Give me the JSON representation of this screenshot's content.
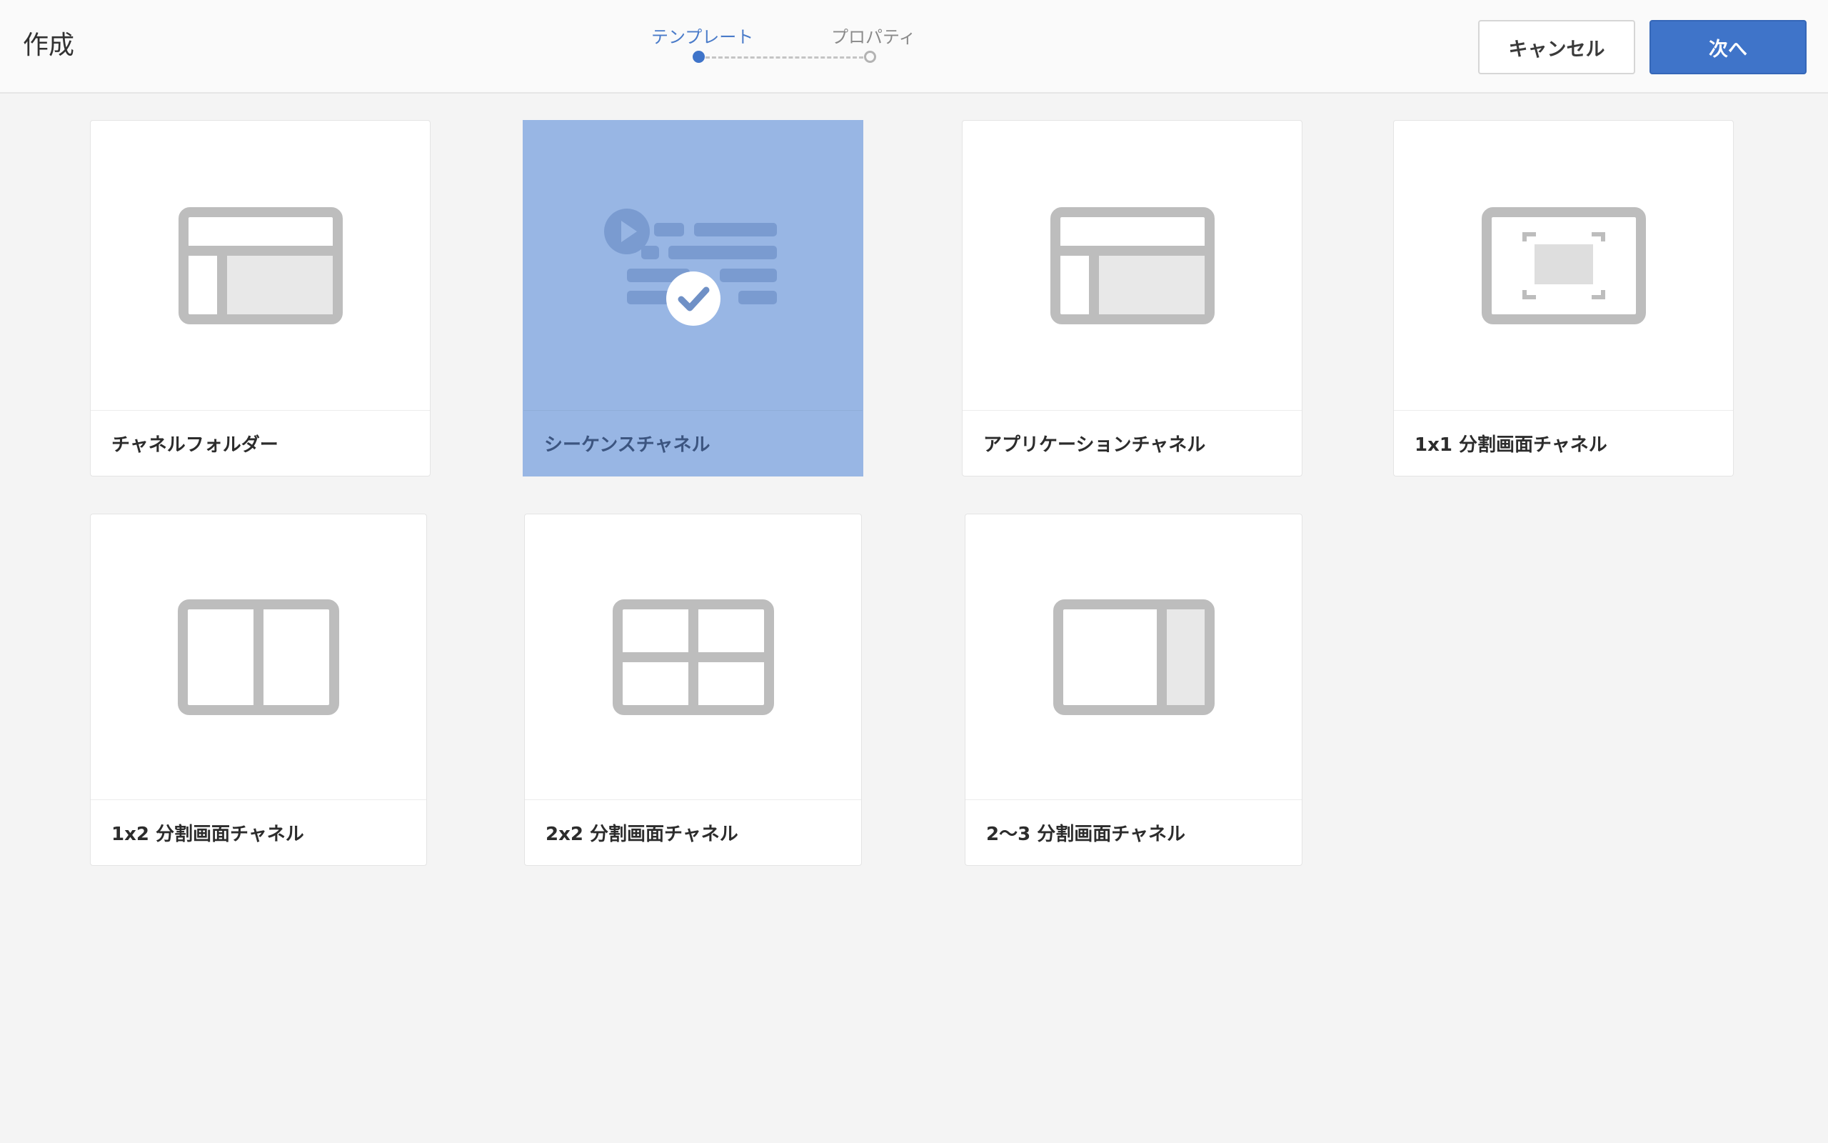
{
  "header": {
    "title": "作成",
    "steps": [
      {
        "label": "テンプレート",
        "state": "active"
      },
      {
        "label": "プロパティ",
        "state": "inactive"
      }
    ],
    "cancel_label": "キャンセル",
    "next_label": "次へ"
  },
  "templates": [
    {
      "label": "チャネルフォルダー",
      "icon": "layout-sidebar-icon",
      "selected": false
    },
    {
      "label": "シーケンスチャネル",
      "icon": "sequence-playlist-icon",
      "selected": true
    },
    {
      "label": "アプリケーションチャネル",
      "icon": "layout-sidebar-icon",
      "selected": false
    },
    {
      "label": "1x1 分割画面チャネル",
      "icon": "fullscreen-icon",
      "selected": false
    },
    {
      "label": "1x2 分割画面チャネル",
      "icon": "split-two-columns-icon",
      "selected": false
    },
    {
      "label": "2x2 分割画面チャネル",
      "icon": "split-grid-four-icon",
      "selected": false
    },
    {
      "label": "2～3 分割画面チャネル",
      "icon": "split-two-thirds-icon",
      "selected": false
    }
  ],
  "colors": {
    "accent": "#3f74c9",
    "selected_card": "#98b6e4",
    "icon_gray": "#bdbdbd",
    "background": "#f4f4f4"
  }
}
